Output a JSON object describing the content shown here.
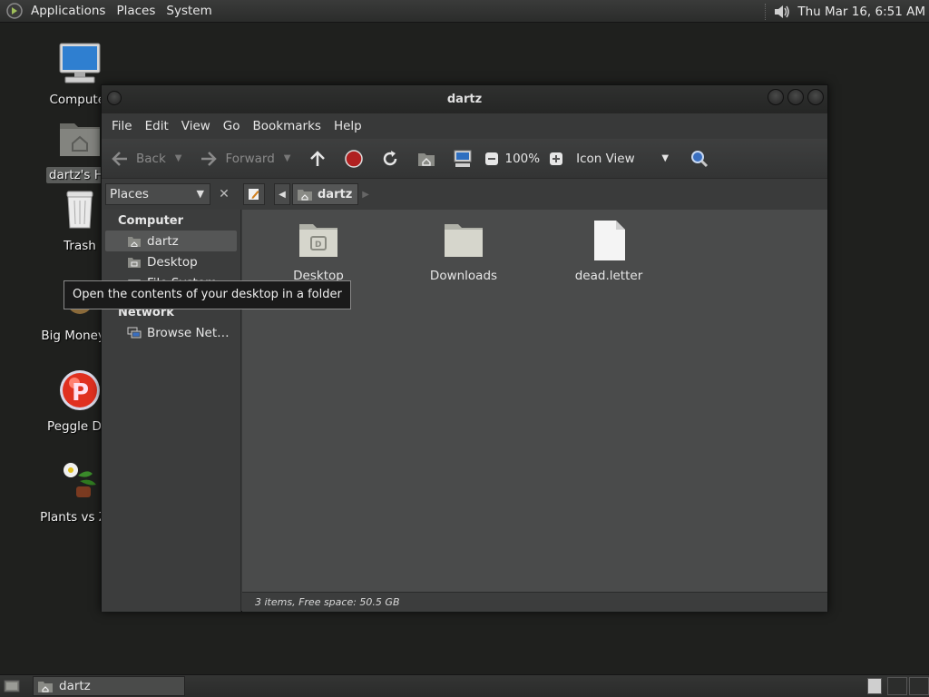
{
  "top_panel": {
    "menus": [
      "Applications",
      "Places",
      "System"
    ],
    "clock": "Thu Mar 16,  6:51 AM"
  },
  "desktop_icons": [
    {
      "label": "Computer",
      "icon": "computer-icon"
    },
    {
      "label": "dartz's Ho",
      "icon": "home-folder-icon",
      "selected": true
    },
    {
      "label": "Trash",
      "icon": "trash-icon"
    },
    {
      "label": "Big Money D",
      "icon": "game-icon"
    },
    {
      "label": "Peggle Del",
      "icon": "peggle-icon"
    },
    {
      "label": "Plants vs Zor",
      "icon": "plants-vs-zombies-icon"
    }
  ],
  "window": {
    "title": "dartz",
    "menu": [
      "File",
      "Edit",
      "View",
      "Go",
      "Bookmarks",
      "Help"
    ],
    "toolbar": {
      "back": "Back",
      "forward": "Forward",
      "zoom": "100%",
      "view_mode": "Icon View"
    },
    "sidebar": {
      "selector": "Places",
      "sections": [
        {
          "heading": "Computer",
          "items": [
            "dartz",
            "Desktop",
            "File System"
          ]
        },
        {
          "heading": "Network",
          "items": [
            "Browse Net…"
          ]
        }
      ]
    },
    "breadcrumb": {
      "current": "dartz"
    },
    "files": [
      {
        "name": "Desktop",
        "icon": "desktop-folder-icon"
      },
      {
        "name": "Downloads",
        "icon": "folder-icon"
      },
      {
        "name": "dead.letter",
        "icon": "text-file-icon"
      }
    ],
    "status": "3 items, Free space: 50.5 GB"
  },
  "tooltip": "Open the contents of your desktop in a folder",
  "taskbar": {
    "tasks": [
      "dartz"
    ]
  },
  "colors": {
    "desktop_bg": "#1f201e",
    "content_bg": "#4a4b4b",
    "window_bg": "#3a3b3b"
  }
}
